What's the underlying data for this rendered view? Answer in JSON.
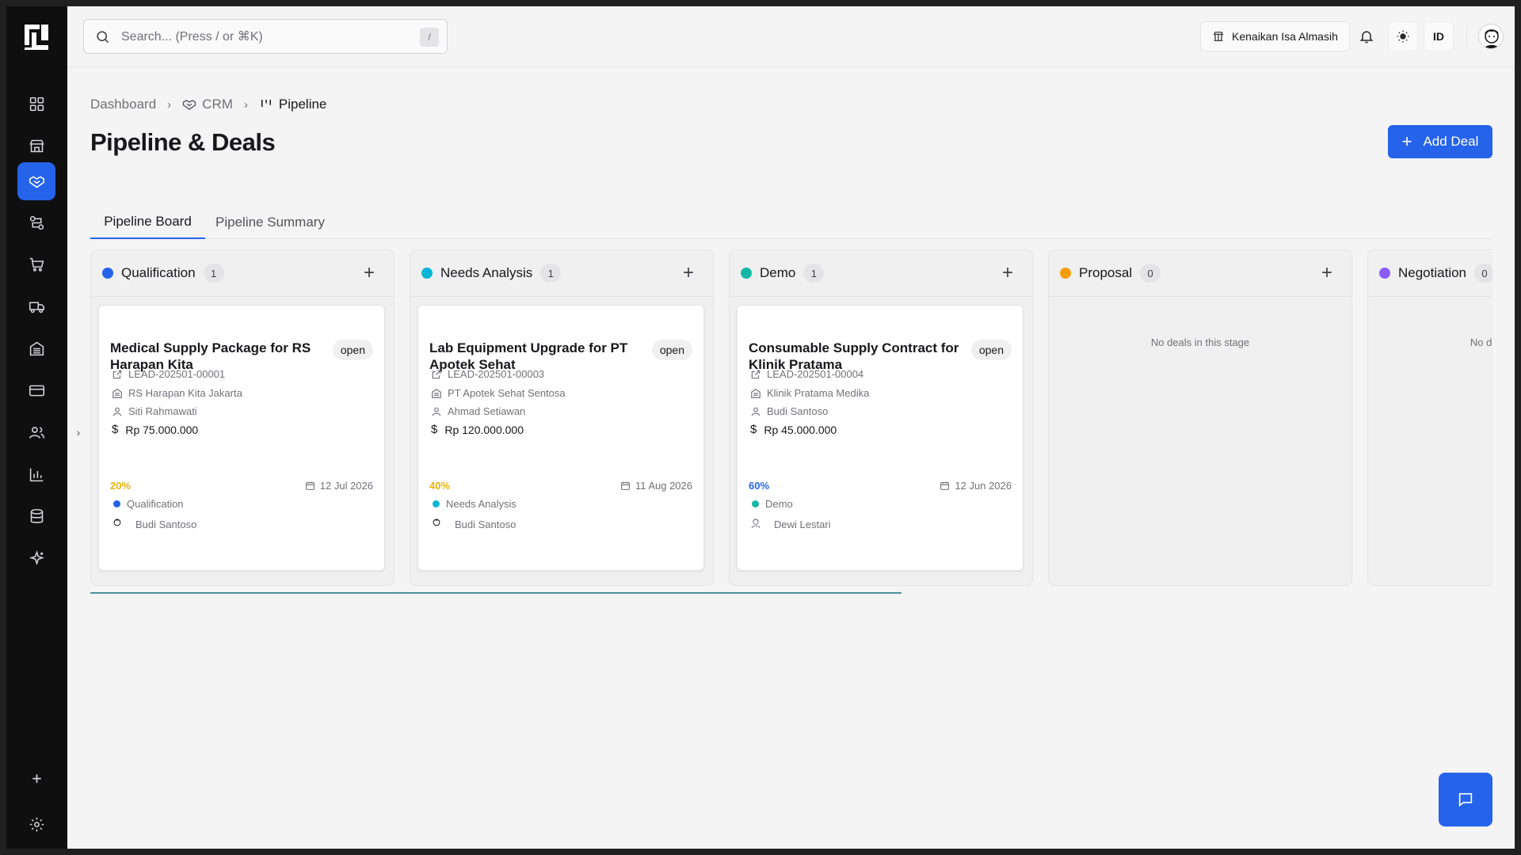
{
  "app": {
    "colors": {
      "accent": "#2563eb",
      "sidebar_bg": "#0f0f10"
    }
  },
  "sidebar": {
    "items": [
      {
        "name": "dashboard-icon",
        "active": false
      },
      {
        "name": "store-icon",
        "active": false
      },
      {
        "name": "handshake-icon",
        "active": true
      },
      {
        "name": "workflow-icon",
        "active": false
      },
      {
        "name": "cart-icon",
        "active": false
      },
      {
        "name": "truck-icon",
        "active": false
      },
      {
        "name": "building-icon",
        "active": false
      },
      {
        "name": "credit-card-icon",
        "active": false
      },
      {
        "name": "users-icon",
        "active": false
      },
      {
        "name": "bar-chart-icon",
        "active": false
      },
      {
        "name": "database-icon",
        "active": false
      },
      {
        "name": "sparkles-icon",
        "active": false
      }
    ],
    "bottom": {
      "add_icon": "plus-icon",
      "settings_icon": "gear-icon"
    },
    "collapse_glyph": "›"
  },
  "header": {
    "search_placeholder": "Search... (Press / or ⌘K)",
    "search_shortcut": "/",
    "tenant": "Kenaikan Isa Almasih",
    "language": "ID"
  },
  "breadcrumb": {
    "items": [
      "Dashboard",
      "CRM",
      "Pipeline"
    ],
    "separator": "›"
  },
  "page": {
    "title": "Pipeline & Deals",
    "add_button": "Add Deal",
    "add_glyph": "+"
  },
  "tabs": [
    {
      "label": "Pipeline Board",
      "active": true
    },
    {
      "label": "Pipeline Summary",
      "active": false
    }
  ],
  "board": {
    "empty_text": "No deals in this stage",
    "columns": [
      {
        "name": "Qualification",
        "count": "1",
        "color": "#2563eb",
        "card": {
          "title": "Medical Supply Package for RS Harapan Kita",
          "status": "open",
          "lead_id": "LEAD-202501-00001",
          "company": "RS Harapan Kita Jakarta",
          "contact": "Siti Rahmawati",
          "currency_glyph": "$",
          "value": "Rp 75.000.000",
          "probability": "20%",
          "probability_color": "#eab308",
          "close_date": "12 Jul 2026",
          "stage": "Qualification",
          "owner": "Budi Santoso"
        }
      },
      {
        "name": "Needs Analysis",
        "count": "1",
        "color": "#06b6d4",
        "card": {
          "title": "Lab Equipment Upgrade for PT Apotek Sehat",
          "status": "open",
          "lead_id": "LEAD-202501-00003",
          "company": "PT Apotek Sehat Sentosa",
          "contact": "Ahmad Setiawan",
          "currency_glyph": "$",
          "value": "Rp 120.000.000",
          "probability": "40%",
          "probability_color": "#eab308",
          "close_date": "11 Aug 2026",
          "stage": "Needs Analysis",
          "owner": "Budi Santoso"
        }
      },
      {
        "name": "Demo",
        "count": "1",
        "color": "#14b8a6",
        "card": {
          "title": "Consumable Supply Contract for Klinik Pratama",
          "status": "open",
          "lead_id": "LEAD-202501-00004",
          "company": "Klinik Pratama Medika",
          "contact": "Budi Santoso",
          "currency_glyph": "$",
          "value": "Rp 45.000.000",
          "probability": "60%",
          "probability_color": "#2563eb",
          "close_date": "12 Jun 2026",
          "stage": "Demo",
          "owner": "Dewi Lestari"
        }
      },
      {
        "name": "Proposal",
        "count": "0",
        "color": "#f59e0b",
        "card": null
      },
      {
        "name": "Negotiation",
        "count": "0",
        "color": "#8b5cf6",
        "card": null
      }
    ]
  },
  "chat": {
    "icon": "message-icon"
  }
}
